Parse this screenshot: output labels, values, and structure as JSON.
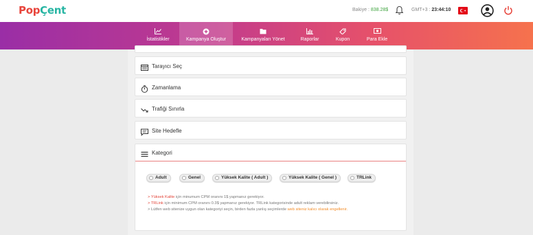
{
  "header": {
    "logo_part1": "Pop",
    "logo_part2": "Çent",
    "balance_label": "Bakiye :",
    "balance_value": "838.28$",
    "timezone_label": "GMT+3 :",
    "time": "23:44:10"
  },
  "nav": {
    "items": [
      {
        "label": "İstatistikler",
        "icon": "chart-icon"
      },
      {
        "label": "Kampanya Oluştur",
        "icon": "plus-circle-icon",
        "active": true
      },
      {
        "label": "Kampanyaları Yönet",
        "icon": "folder-icon"
      },
      {
        "label": "Raporlar",
        "icon": "bar-chart-icon"
      },
      {
        "label": "Kupon",
        "icon": "ticket-icon"
      },
      {
        "label": "Para Ekle",
        "icon": "money-icon"
      }
    ]
  },
  "sections": {
    "browser": "Tarayıcı Seç",
    "schedule": "Zamanlama",
    "traffic": "Trafiği Sınırla",
    "site": "Site Hedefle",
    "category": "Kategori"
  },
  "category_options": [
    "Adult",
    "Genel",
    "Yüksek Kalite ( Adult )",
    "Yüksek Kalite ( Genel )",
    "TRLink"
  ],
  "notes": {
    "line1_prefix": "> ",
    "line1_highlight": "Yüksek Kalite",
    "line1_rest": " için minumum CPM oranını 1$ yapmanız gerekiyor.",
    "line2_prefix": "> ",
    "line2_highlight": "TRLink",
    "line2_rest": " için minimum CPM oranını 0.3$ yapmanız gerekiyor. TRLink kategorisinde adult reklam verebilirsiniz.",
    "line3_text": "> Lütfen web sitenize uygun olan kategoriyi seçin, birden fazla yanlış seçimlerde ",
    "line3_highlight": "web siteniz kalıcı olarak engellenir."
  },
  "colors": {
    "nav_start": "#9a2ea6",
    "nav_end": "#f6724d",
    "logo_red": "#e8453c",
    "logo_teal": "#27b5a3",
    "balance_green": "#3fa33f",
    "power_red": "#e8453c",
    "note_red": "#e3453a",
    "note_orange": "#f28c28"
  }
}
